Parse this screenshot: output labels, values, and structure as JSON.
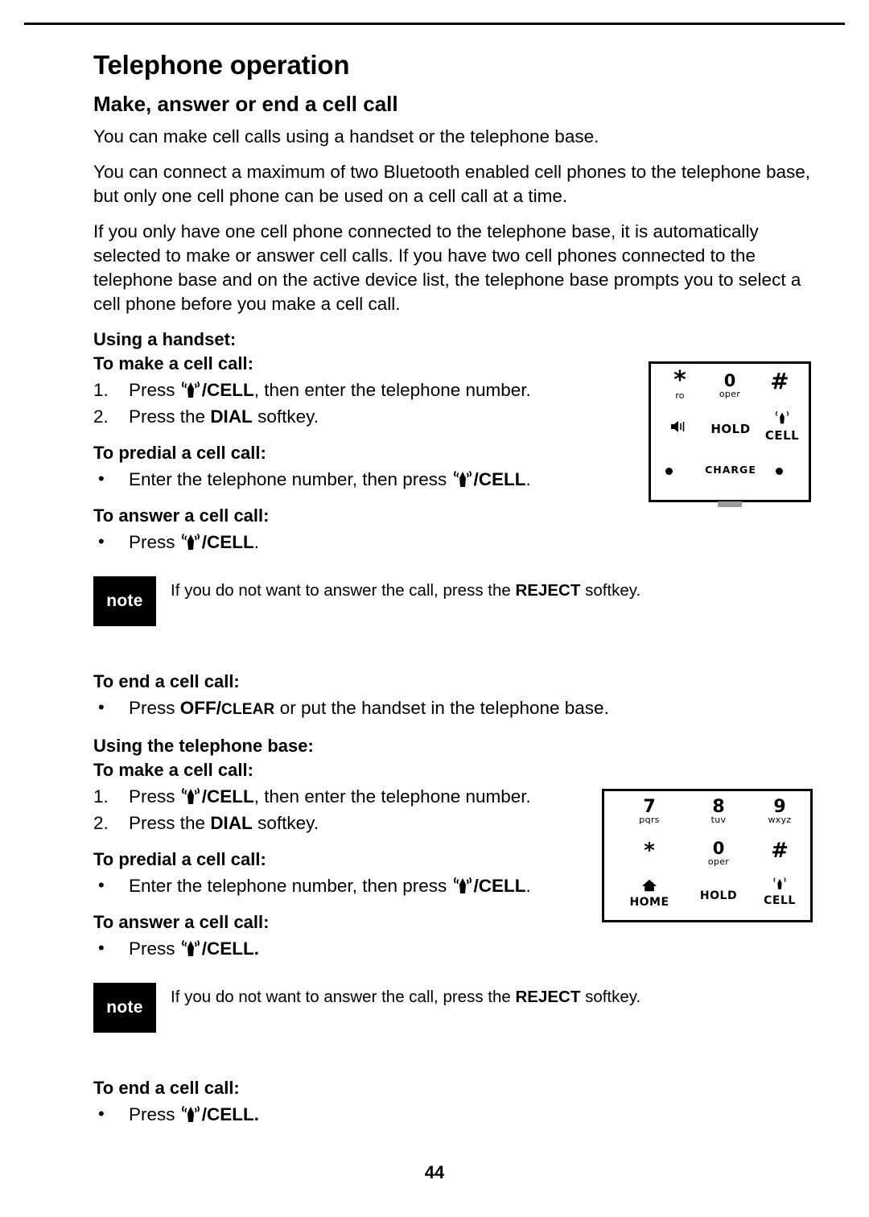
{
  "document": {
    "chapter_title": "Telephone operation",
    "section_title": "Make, answer or end a cell call",
    "page_number": "44"
  },
  "paragraphs": [
    "You can make cell calls using a handset or the telephone base.",
    "You can connect a maximum of two Bluetooth enabled cell phones to the telephone base, but only one cell phone can be used on a cell call at a time.",
    "If you only have one cell phone connected to the telephone base, it is automatically selected to make or answer cell calls. If you have two cell phones connected to the telephone base and on the active device list, the telephone base prompts you to select a cell phone before you make a cell call."
  ],
  "handset": {
    "heading": "Using a handset:",
    "make": {
      "heading": "To make a cell call:",
      "step1_num": "1.",
      "step1_pre": "Press",
      "step1_cell": "/CELL",
      "step1_post": ", then enter the telephone number.",
      "step2_num": "2.",
      "step2_pre": "Press the",
      "step2_key": "DIAL",
      "step2_post": "softkey."
    },
    "predial": {
      "heading": "To predial a cell call:",
      "bullet_pre": "Enter the telephone number, then press",
      "bullet_cell": "/CELL",
      "bullet_post": "."
    },
    "answer": {
      "heading": "To answer a cell call:",
      "bullet_pre": "Press",
      "bullet_cell": "/CELL",
      "bullet_post": "."
    },
    "note": {
      "badge": "note",
      "pre": "If you do not want to answer the call, press the",
      "key": "REJECT",
      "post": "softkey."
    },
    "end": {
      "heading": "To end a cell call:",
      "bullet_pre": "Press",
      "key_off": "OFF/",
      "key_clear": "CLEAR",
      "bullet_post": "or put the handset in the telephone base."
    }
  },
  "base": {
    "heading": "Using the telephone base:",
    "make": {
      "heading": "To make a cell call:",
      "step1_num": "1.",
      "step1_pre": "Press",
      "step1_cell": "/CELL",
      "step1_post": ", then enter the telephone number.",
      "step2_num": "2.",
      "step2_pre": "Press the",
      "step2_key": "DIAL",
      "step2_post": "softkey."
    },
    "predial": {
      "heading": "To predial a cell call:",
      "bullet_pre": "Enter the telephone number, then press",
      "bullet_cell": "/CELL",
      "bullet_post": "."
    },
    "answer": {
      "heading": "To answer a cell call:",
      "bullet_pre": "Press",
      "bullet_cell": "/CELL",
      "bullet_post": "."
    },
    "note": {
      "badge": "note",
      "pre": "If you do not want to answer the call, press the",
      "key": "REJECT",
      "post": "softkey."
    },
    "end": {
      "heading": "To end a cell call:",
      "bullet_pre": "Press",
      "bullet_cell": "/CELL",
      "bullet_post": "."
    }
  },
  "figures": {
    "handset_keypad": {
      "star_digit": "*",
      "star_sub": "ro",
      "zero_digit": "0",
      "zero_sub": "oper",
      "hash_digit": "#",
      "mute_icon": "speaker-mute-icon",
      "hold_label": "HOLD",
      "cell_label": "CELL",
      "charge_label": "CHARGE"
    },
    "base_keypad": {
      "keys": [
        {
          "digit": "7",
          "sub": "pqrs"
        },
        {
          "digit": "8",
          "sub": "tuv"
        },
        {
          "digit": "9",
          "sub": "wxyz"
        },
        {
          "digit": "*",
          "sub": ""
        },
        {
          "digit": "0",
          "sub": "oper"
        },
        {
          "digit": "#",
          "sub": ""
        }
      ],
      "home_label": "HOME",
      "hold_label": "HOLD",
      "cell_label": "CELL"
    }
  }
}
